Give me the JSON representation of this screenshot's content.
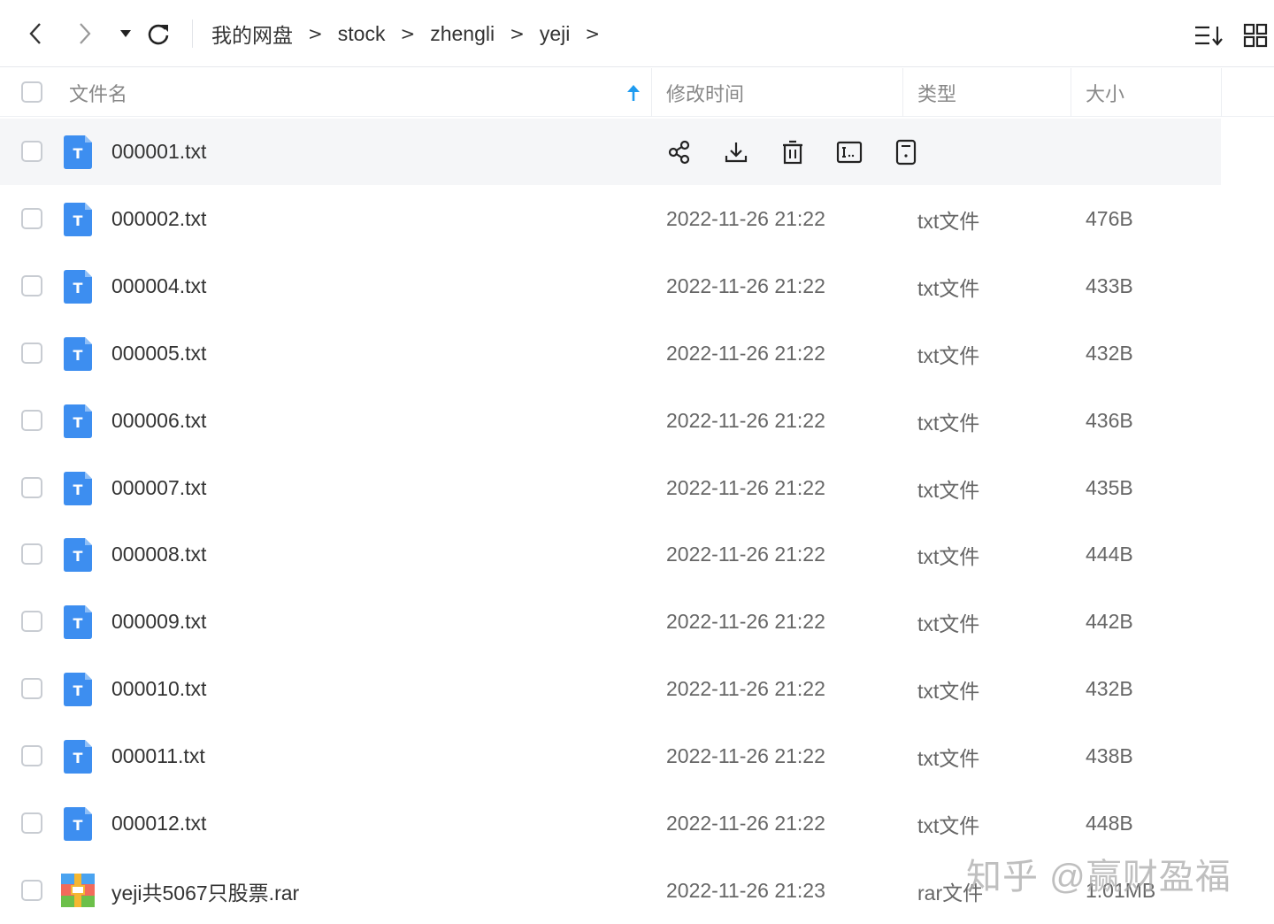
{
  "toolbar": {
    "back_icon": "chevron-left-icon",
    "forward_icon": "chevron-right-icon",
    "history_icon": "caret-down-icon",
    "refresh_icon": "refresh-icon",
    "breadcrumb": [
      "我的网盘",
      "stock",
      "zhengli",
      "yeji"
    ],
    "separator": ">",
    "sort_icon": "sort-icon",
    "grid_icon": "grid-view-icon"
  },
  "header": {
    "name": "文件名",
    "modified": "修改时间",
    "type": "类型",
    "size": "大小",
    "sort_indicator": "arrow-up-icon"
  },
  "files": [
    {
      "name": "000001.txt",
      "date": "",
      "type": "",
      "size": "",
      "icon": "txt"
    },
    {
      "name": "000002.txt",
      "date": "2022-11-26 21:22",
      "type": "txt文件",
      "size": "476B",
      "icon": "txt"
    },
    {
      "name": "000004.txt",
      "date": "2022-11-26 21:22",
      "type": "txt文件",
      "size": "433B",
      "icon": "txt"
    },
    {
      "name": "000005.txt",
      "date": "2022-11-26 21:22",
      "type": "txt文件",
      "size": "432B",
      "icon": "txt"
    },
    {
      "name": "000006.txt",
      "date": "2022-11-26 21:22",
      "type": "txt文件",
      "size": "436B",
      "icon": "txt"
    },
    {
      "name": "000007.txt",
      "date": "2022-11-26 21:22",
      "type": "txt文件",
      "size": "435B",
      "icon": "txt"
    },
    {
      "name": "000008.txt",
      "date": "2022-11-26 21:22",
      "type": "txt文件",
      "size": "444B",
      "icon": "txt"
    },
    {
      "name": "000009.txt",
      "date": "2022-11-26 21:22",
      "type": "txt文件",
      "size": "442B",
      "icon": "txt"
    },
    {
      "name": "000010.txt",
      "date": "2022-11-26 21:22",
      "type": "txt文件",
      "size": "432B",
      "icon": "txt"
    },
    {
      "name": "000011.txt",
      "date": "2022-11-26 21:22",
      "type": "txt文件",
      "size": "438B",
      "icon": "txt"
    },
    {
      "name": "000012.txt",
      "date": "2022-11-26 21:22",
      "type": "txt文件",
      "size": "448B",
      "icon": "txt"
    },
    {
      "name": "yeji共5067只股票.rar",
      "date": "2022-11-26 21:23",
      "type": "rar文件",
      "size": "1.01MB",
      "icon": "rar"
    }
  ],
  "row_actions": [
    "share-icon",
    "download-icon",
    "delete-icon",
    "rename-icon",
    "more-icon"
  ],
  "txt_icon_letter": "T",
  "watermark": "知乎 @赢财盈福",
  "colors": {
    "accent": "#1e9bf0",
    "txt_icon": "#3d8ef0",
    "hover_row": "#f5f6f8"
  }
}
